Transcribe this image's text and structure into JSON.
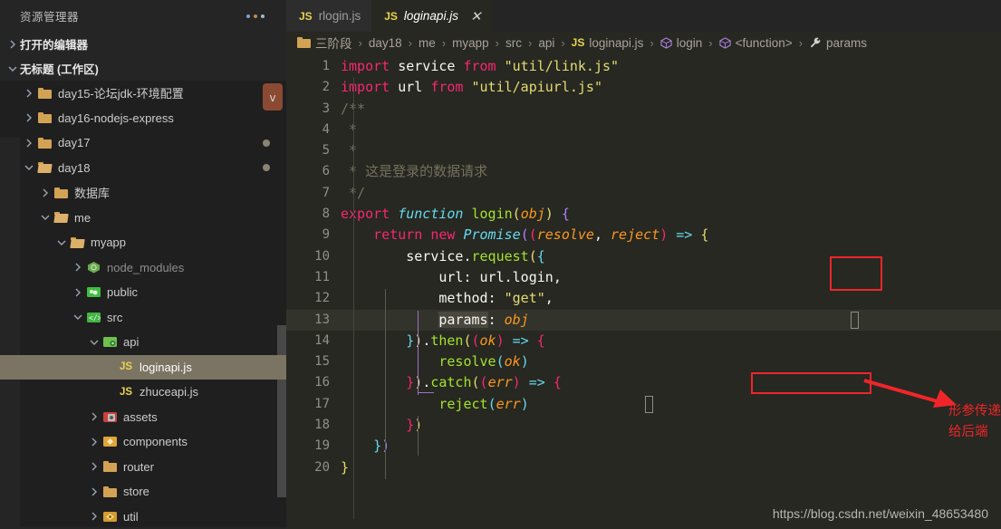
{
  "sidebar": {
    "title": "资源管理器",
    "more_actions_icon": "more-dots-icon",
    "sections": [
      {
        "label": "打开的编辑器",
        "expanded": false
      },
      {
        "label": "无标题 (工作区)",
        "expanded": true
      }
    ],
    "tree": [
      {
        "label": "day15-论坛jdk-环境配置",
        "indent": 1,
        "icon": "folder-icon",
        "arrow": "chevron-right",
        "badge": "v"
      },
      {
        "label": "day16-nodejs-express",
        "indent": 1,
        "icon": "folder-icon",
        "arrow": "chevron-right"
      },
      {
        "label": "day17",
        "indent": 1,
        "icon": "folder-icon",
        "arrow": "chevron-right",
        "dot": true
      },
      {
        "label": "day18",
        "indent": 1,
        "icon": "folder-open-icon",
        "arrow": "chevron-down",
        "dot": true
      },
      {
        "label": "数据库",
        "indent": 2,
        "icon": "folder-icon",
        "arrow": "chevron-right"
      },
      {
        "label": "me",
        "indent": 2,
        "icon": "folder-open-icon",
        "arrow": "chevron-down"
      },
      {
        "label": "myapp",
        "indent": 3,
        "icon": "folder-open-icon",
        "arrow": "chevron-down"
      },
      {
        "label": "node_modules",
        "indent": 4,
        "icon": "node-modules-icon",
        "arrow": "chevron-right",
        "dimmed": true
      },
      {
        "label": "public",
        "indent": 4,
        "icon": "public-folder-icon",
        "arrow": "chevron-right"
      },
      {
        "label": "src",
        "indent": 4,
        "icon": "src-folder-icon",
        "arrow": "chevron-down"
      },
      {
        "label": "api",
        "indent": 5,
        "icon": "api-folder-icon",
        "arrow": "chevron-down"
      },
      {
        "label": "loginapi.js",
        "indent": 6,
        "icon": "js-file-icon",
        "selected": true
      },
      {
        "label": "zhuceapi.js",
        "indent": 6,
        "icon": "js-file-icon"
      },
      {
        "label": "assets",
        "indent": 5,
        "icon": "assets-folder-icon",
        "arrow": "chevron-right"
      },
      {
        "label": "components",
        "indent": 5,
        "icon": "components-folder-icon",
        "arrow": "chevron-right"
      },
      {
        "label": "router",
        "indent": 5,
        "icon": "folder-icon",
        "arrow": "chevron-right"
      },
      {
        "label": "store",
        "indent": 5,
        "icon": "folder-icon",
        "arrow": "chevron-right"
      },
      {
        "label": "util",
        "indent": 5,
        "icon": "util-folder-icon",
        "arrow": "chevron-right"
      }
    ]
  },
  "tabs": [
    {
      "label": "rlogin.js",
      "icon": "js-file-icon",
      "active": false,
      "closable": false
    },
    {
      "label": "loginapi.js",
      "icon": "js-file-icon",
      "active": true,
      "closable": true,
      "close_label": "✕"
    }
  ],
  "breadcrumb": {
    "items": [
      {
        "label": "三阶段",
        "icon": "folder-icon"
      },
      {
        "label": "day18"
      },
      {
        "label": "me"
      },
      {
        "label": "myapp"
      },
      {
        "label": "src"
      },
      {
        "label": "api"
      },
      {
        "label": "loginapi.js",
        "icon": "js-file-icon"
      },
      {
        "label": "login",
        "icon": "symbol-cube-icon"
      },
      {
        "label": "<function>",
        "icon": "symbol-cube-icon"
      },
      {
        "label": "params",
        "icon": "wrench-icon"
      }
    ],
    "separator": "›"
  },
  "code": {
    "language": "javascript",
    "first_line": 1,
    "last_line": 20,
    "current_line": 13,
    "lines": [
      {
        "n": 1,
        "text": "import service from \"util/link.js\""
      },
      {
        "n": 2,
        "text": "import url from \"util/apiurl.js\""
      },
      {
        "n": 3,
        "text": "/**"
      },
      {
        "n": 4,
        "text": " *"
      },
      {
        "n": 5,
        "text": " *"
      },
      {
        "n": 6,
        "text": " * 这是登录的数据请求"
      },
      {
        "n": 7,
        "text": " */"
      },
      {
        "n": 8,
        "text": "export function login(obj) {"
      },
      {
        "n": 9,
        "text": "    return new Promise((resolve, reject) => {"
      },
      {
        "n": 10,
        "text": "        service.request({"
      },
      {
        "n": 11,
        "text": "            url: url.login,"
      },
      {
        "n": 12,
        "text": "            method: \"get\","
      },
      {
        "n": 13,
        "text": "            params: obj"
      },
      {
        "n": 14,
        "text": "        }).then((ok) => {"
      },
      {
        "n": 15,
        "text": "            resolve(ok)"
      },
      {
        "n": 16,
        "text": "        }).catch((err) => {"
      },
      {
        "n": 17,
        "text": "            reject(err)"
      },
      {
        "n": 18,
        "text": "        })"
      },
      {
        "n": 19,
        "text": "    })"
      },
      {
        "n": 20,
        "text": "}"
      }
    ]
  },
  "annotations": {
    "color": "#f0252a",
    "boxes": [
      {
        "name": "obj-param-highlight",
        "target": "(obj)"
      },
      {
        "name": "params-obj-highlight",
        "target": "params: obj"
      }
    ],
    "note": "形参传递给后端"
  },
  "watermark": "https://blog.csdn.net/weixin_48653480",
  "colors": {
    "editor_bg": "#262821",
    "sidebar_bg": "#252526",
    "tree_bg": "#1f1f1f",
    "selection": "#7c7463",
    "annotation_red": "#f0252a",
    "js_yellow": "#e8d44d"
  }
}
